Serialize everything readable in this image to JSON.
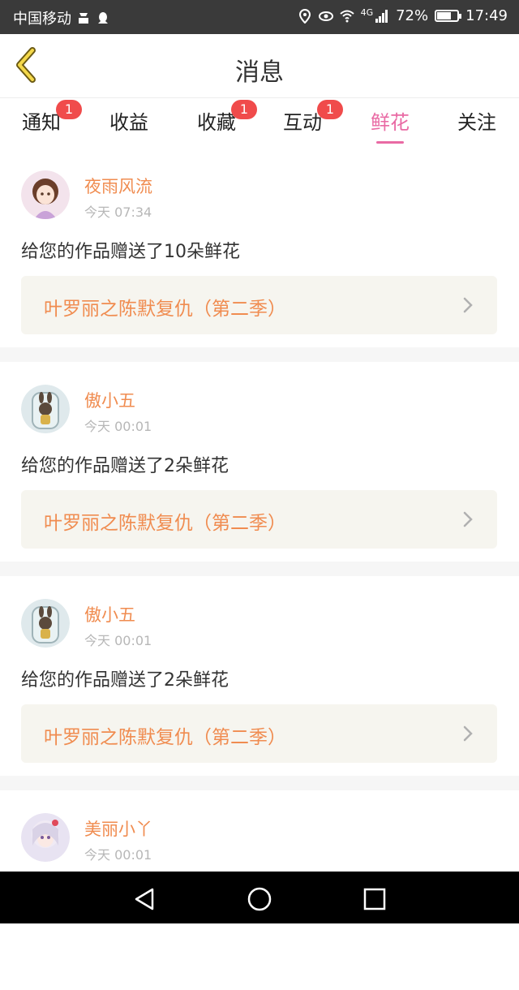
{
  "status": {
    "carrier": "中国移动",
    "network": "4G",
    "battery": "72%",
    "battery_level": 0.72,
    "time": "17:49"
  },
  "header": {
    "title": "消息"
  },
  "tabs": [
    {
      "label": "通知",
      "badge": "1"
    },
    {
      "label": "收益",
      "badge": ""
    },
    {
      "label": "收藏",
      "badge": "1"
    },
    {
      "label": "互动",
      "badge": "1"
    },
    {
      "label": "鲜花",
      "badge": "",
      "active": true
    },
    {
      "label": "关注",
      "badge": ""
    }
  ],
  "messages": [
    {
      "name": "夜雨风流",
      "time": "今天 07:34",
      "text": "给您的作品赠送了10朵鲜花",
      "work": "叶罗丽之陈默复仇（第二季）"
    },
    {
      "name": "傲小五",
      "time": "今天 00:01",
      "text": "给您的作品赠送了2朵鲜花",
      "work": "叶罗丽之陈默复仇（第二季）"
    },
    {
      "name": "傲小五",
      "time": "今天 00:01",
      "text": "给您的作品赠送了2朵鲜花",
      "work": "叶罗丽之陈默复仇（第二季）"
    },
    {
      "name": "美丽小丫",
      "time": "今天 00:01",
      "text": "",
      "work": ""
    }
  ]
}
